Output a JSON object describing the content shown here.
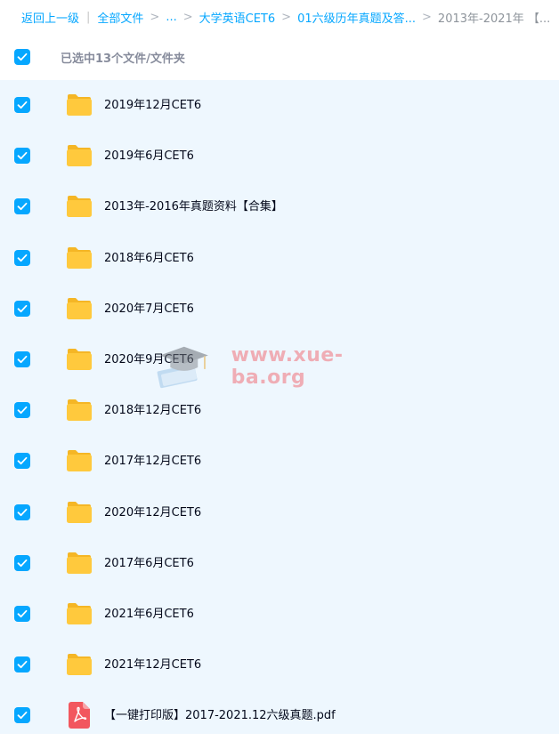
{
  "breadcrumb": {
    "back": "返回上一级",
    "all_files": "全部文件",
    "ellipsis": "...",
    "level1": "大学英语CET6",
    "level2": "01六级历年真题及答...",
    "current": "2013年-2021年 【..."
  },
  "selection": {
    "count_text": "已选中13个文件/文件夹",
    "all_selected": true
  },
  "files": [
    {
      "name": "2019年12月CET6",
      "type": "folder",
      "checked": true
    },
    {
      "name": "2019年6月CET6",
      "type": "folder",
      "checked": true
    },
    {
      "name": "2013年-2016年真题资料【合集】",
      "type": "folder",
      "checked": true
    },
    {
      "name": "2018年6月CET6",
      "type": "folder",
      "checked": true
    },
    {
      "name": "2020年7月CET6",
      "type": "folder",
      "checked": true
    },
    {
      "name": "2020年9月CET6",
      "type": "folder",
      "checked": true
    },
    {
      "name": "2018年12月CET6",
      "type": "folder",
      "checked": true
    },
    {
      "name": "2017年12月CET6",
      "type": "folder",
      "checked": true
    },
    {
      "name": "2020年12月CET6",
      "type": "folder",
      "checked": true
    },
    {
      "name": "2017年6月CET6",
      "type": "folder",
      "checked": true
    },
    {
      "name": "2021年6月CET6",
      "type": "folder",
      "checked": true
    },
    {
      "name": "2021年12月CET6",
      "type": "folder",
      "checked": true
    },
    {
      "name": "【一键打印版】2017-2021.12六级真题.pdf",
      "type": "pdf",
      "checked": true
    }
  ],
  "watermark": {
    "text": "www.xue-ba.org"
  },
  "colors": {
    "accent": "#06a7ff",
    "list_background": "#eef7fe",
    "folder": "#ffc93d",
    "pdf": "#f2575e"
  }
}
